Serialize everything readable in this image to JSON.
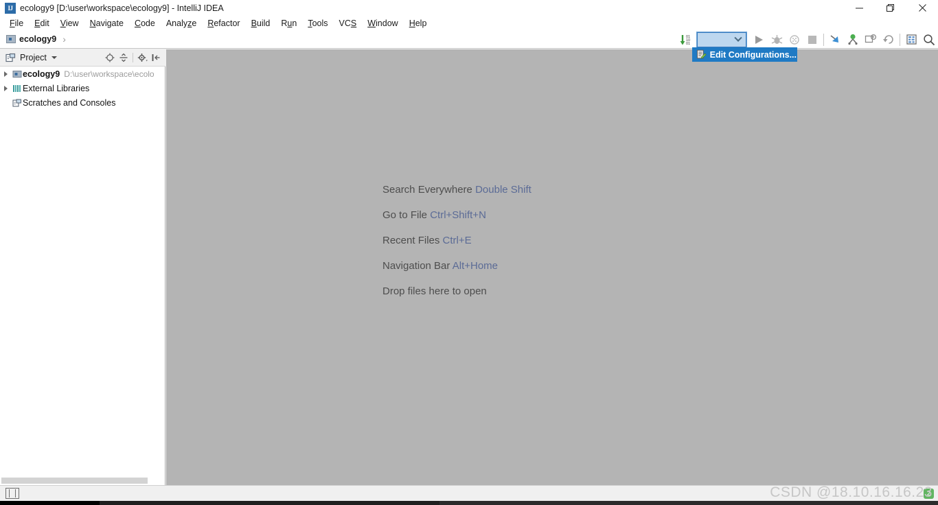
{
  "window": {
    "title": "ecology9 [D:\\user\\workspace\\ecology9] - IntelliJ IDEA",
    "app_icon": "IJ",
    "minimize_label": "—",
    "restore_label": "❐",
    "close_label": "✕"
  },
  "menubar": {
    "items": [
      {
        "label": "File",
        "mnemonic": "F"
      },
      {
        "label": "Edit",
        "mnemonic": "E"
      },
      {
        "label": "View",
        "mnemonic": "V"
      },
      {
        "label": "Navigate",
        "mnemonic": "N"
      },
      {
        "label": "Code",
        "mnemonic": "C"
      },
      {
        "label": "Analyze",
        "mnemonic": "z"
      },
      {
        "label": "Refactor",
        "mnemonic": "R"
      },
      {
        "label": "Build",
        "mnemonic": "B"
      },
      {
        "label": "Run",
        "mnemonic": "u"
      },
      {
        "label": "Tools",
        "mnemonic": "T"
      },
      {
        "label": "VCS",
        "mnemonic": "S"
      },
      {
        "label": "Window",
        "mnemonic": "W"
      },
      {
        "label": "Help",
        "mnemonic": "H"
      }
    ]
  },
  "navbar": {
    "project_name": "ecology9",
    "separator": "›"
  },
  "toolbar": {
    "update_project_icon": "update-project-icon",
    "run_config_value": "",
    "run_config_placeholder": "",
    "run_icon": "run-icon",
    "debug_icon": "debug-icon",
    "coverage_icon": "run-with-coverage-icon",
    "stop_icon": "stop-icon",
    "vcs_update_icon": "vcs-update-icon",
    "vcs_commit_icon": "vcs-commit-icon",
    "vcs_diff_icon": "vcs-diff-icon",
    "vcs_rollback_icon": "vcs-rollback-icon",
    "settings_icon": "settings-icon",
    "search_icon": "search-icon"
  },
  "run_popup": {
    "item_label": "Edit Configurations...",
    "item_icon": "edit-configurations-icon",
    "highlight_color": "#1f7ac4"
  },
  "project_panel": {
    "title": "Project",
    "actions": [
      {
        "name": "select-opened-file-icon"
      },
      {
        "name": "collapse-all-icon"
      },
      {
        "name": "settings-gear-icon"
      },
      {
        "name": "hide-panel-icon"
      }
    ],
    "tree": [
      {
        "label": "ecology9",
        "path": "D:\\user\\workspace\\ecolo",
        "icon": "module-icon",
        "expandable": true,
        "bold": true,
        "indent": 0
      },
      {
        "label": "External Libraries",
        "path": "",
        "icon": "libraries-icon",
        "expandable": true,
        "bold": false,
        "indent": 0
      },
      {
        "label": "Scratches and Consoles",
        "path": "",
        "icon": "scratches-icon",
        "expandable": false,
        "bold": false,
        "indent": 0
      }
    ]
  },
  "editor": {
    "hints": [
      {
        "action": "Search Everywhere",
        "shortcut": "Double Shift"
      },
      {
        "action": "Go to File",
        "shortcut": "Ctrl+Shift+N"
      },
      {
        "action": "Recent Files",
        "shortcut": "Ctrl+E"
      },
      {
        "action": "Navigation Bar",
        "shortcut": "Alt+Home"
      },
      {
        "action": "Drop files here to open",
        "shortcut": ""
      }
    ]
  },
  "statusbar": {
    "toggle_icon": "toggle-tool-windows-icon",
    "notification_count": "2"
  },
  "watermark": {
    "text": "CSDN @18.10.16.16.23"
  },
  "colors": {
    "accent_blue": "#1f7ac4",
    "combo_fill": "#bdd7ef",
    "editor_bg": "#b4b4b4",
    "hint_text": "#4d4d4d",
    "hint_shortcut": "#5b6b96"
  }
}
